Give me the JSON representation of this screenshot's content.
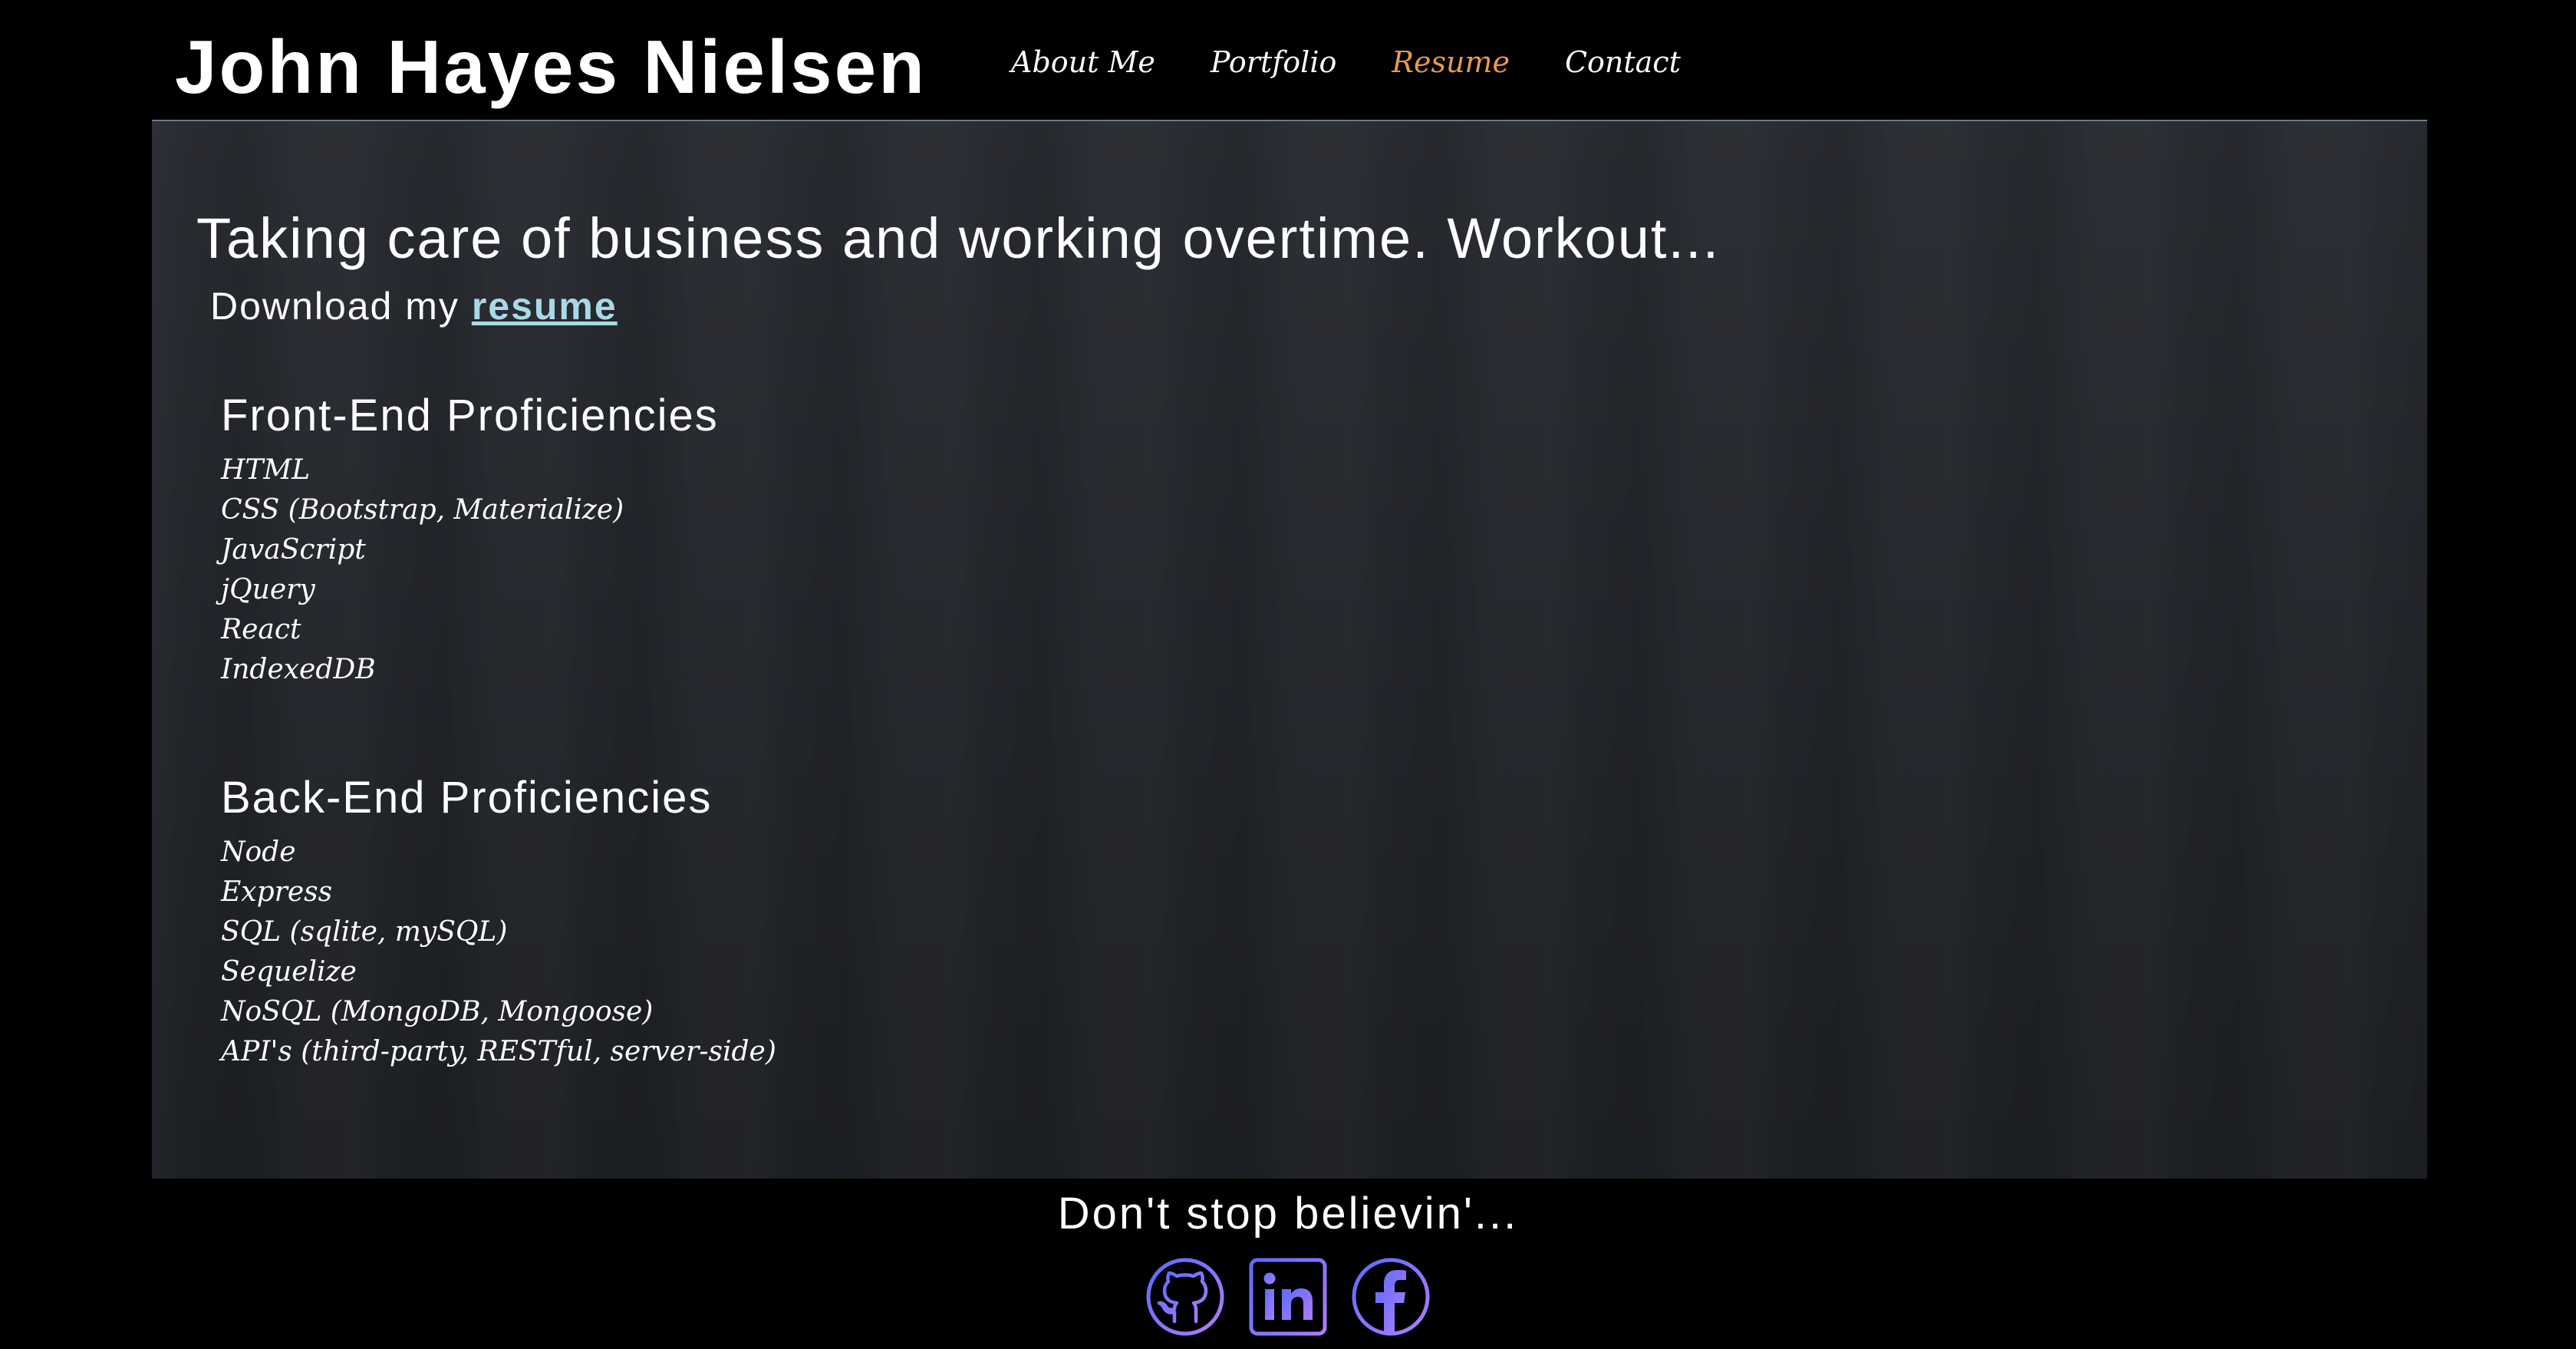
{
  "site": {
    "title": "John Hayes Nielsen"
  },
  "nav": {
    "items": [
      {
        "label": "About Me",
        "active": false
      },
      {
        "label": "Portfolio",
        "active": false
      },
      {
        "label": "Resume",
        "active": true
      },
      {
        "label": "Contact",
        "active": false
      }
    ],
    "active_color": "#e79a4f"
  },
  "main": {
    "tagline": "Taking care of business and working overtime. Workout...",
    "download_prefix": "Download my",
    "download_link": "resume",
    "front_end": {
      "heading": "Front-End Proficiencies",
      "items": [
        "HTML",
        "CSS (Bootstrap, Materialize)",
        "JavaScript",
        "jQuery",
        "React",
        "IndexedDB"
      ]
    },
    "back_end": {
      "heading": "Back-End Proficiencies",
      "items": [
        "Node",
        "Express",
        "SQL (sqlite, mySQL)",
        "Sequelize",
        "NoSQL (MongoDB, Mongoose)",
        "API's (third-party, RESTful, server-side)"
      ]
    }
  },
  "footer": {
    "text": "Don't stop believin'...",
    "socials": [
      {
        "icon": "github-icon"
      },
      {
        "icon": "linkedin-icon"
      },
      {
        "icon": "facebook-icon"
      }
    ]
  },
  "colors": {
    "background": "#000000",
    "panel": "#22252b",
    "link": "#a9d9e6",
    "icon_gradient_start": "#5b6bff",
    "icon_gradient_end": "#b07cff"
  }
}
